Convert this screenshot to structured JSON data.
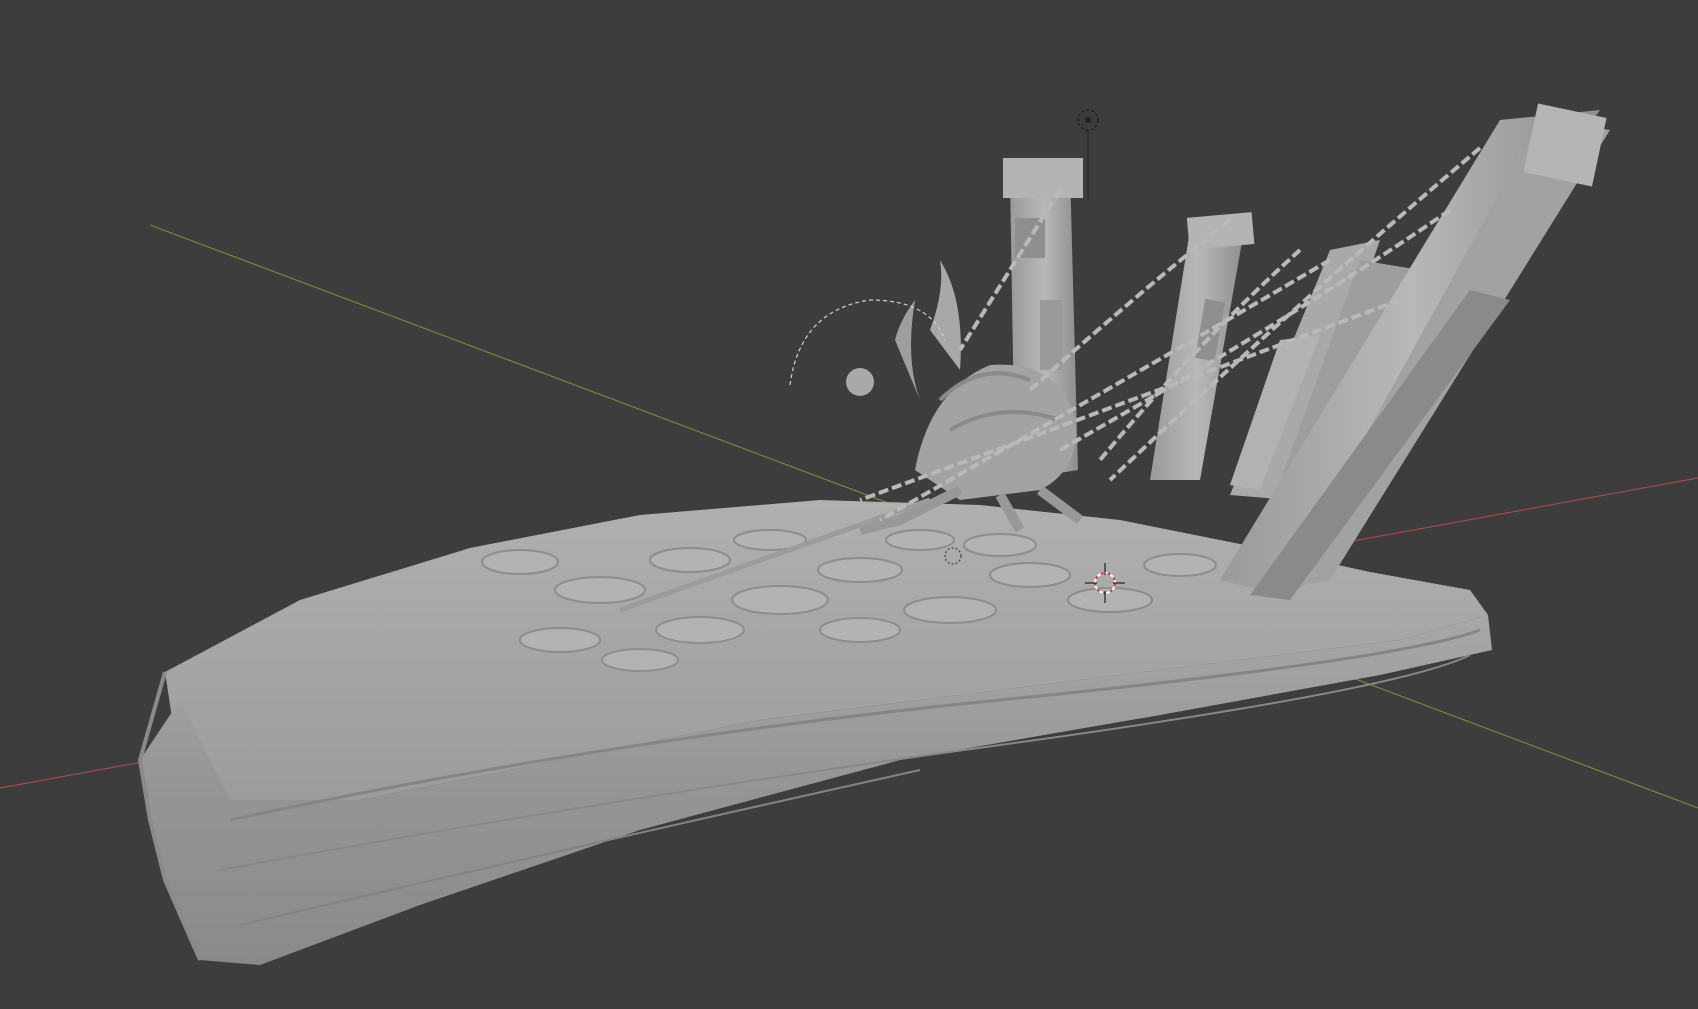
{
  "app": {
    "name_icon": "blender-viewport"
  },
  "viewport": {
    "background_color": "#3d3d3d",
    "axis_x_color": "#a04a52",
    "axis_y_color": "#6f8a3a",
    "model_color": "#a6a6a6",
    "model_shadow_color": "#7c7c7c",
    "model_highlight_color": "#c4c4c4",
    "icons": [
      "3d-cursor-icon",
      "light-object-icon",
      "camera-origin-icon"
    ]
  }
}
